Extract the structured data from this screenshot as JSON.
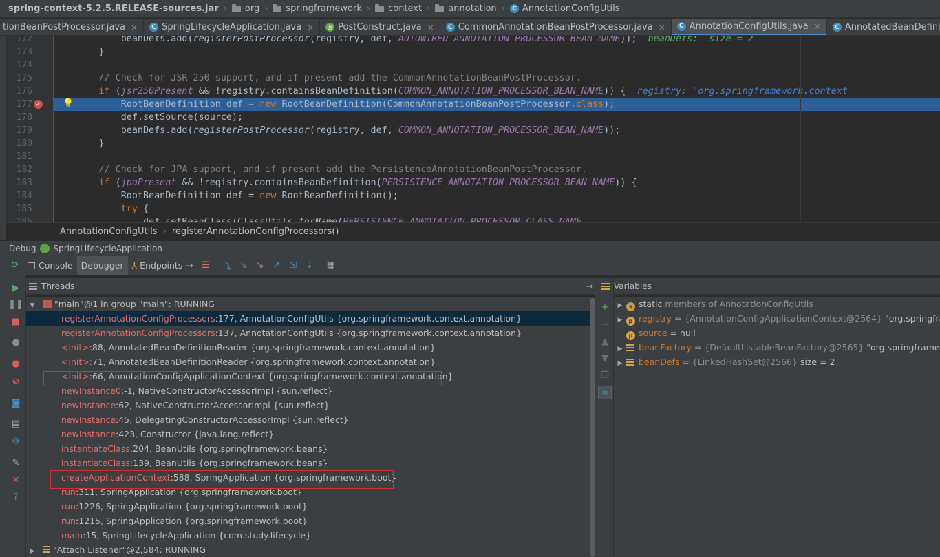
{
  "navbar": {
    "items": [
      "spring-context-5.2.5.RELEASE-sources.jar",
      "org",
      "springframework",
      "context",
      "annotation",
      "AnnotationConfigUtils"
    ]
  },
  "tabs": [
    {
      "label": "tionBeanPostProcessor.java",
      "icon": "class-icon"
    },
    {
      "label": "SpringLifecycleApplication.java",
      "icon": "spring-class-icon"
    },
    {
      "label": "PostConstruct.java",
      "icon": "annotation-icon"
    },
    {
      "label": "CommonAnnotationBeanPostProcessor.java",
      "icon": "class-icon"
    },
    {
      "label": "AnnotationConfigUtils.java",
      "icon": "class-icon",
      "active": true
    },
    {
      "label": "AnnotatedBeanDefinitionReader.java",
      "icon": "class-icon"
    }
  ],
  "editor": {
    "line_numbers": [
      "172",
      "173",
      "174",
      "175",
      "176",
      "177",
      "178",
      "179",
      "180",
      "181",
      "182",
      "183",
      "184",
      "185",
      "186"
    ],
    "current_line": "177",
    "lines": {
      "l172_a": "            beanDefs.add(",
      "l172_b": "registerPostProcessor",
      "l172_c": "(registry, def, ",
      "l172_d": "AUTOWIRED_ANNOTATION_PROCESSOR_BEAN_NAME",
      "l172_e": "));  ",
      "l172_f": "beanDefs:  size = 2",
      "l173": "        }",
      "l175": "        // Check for JSR-250 support, and if present add the CommonAnnotationBeanPostProcessor.",
      "l176_kw": "if",
      "l176_a": " (",
      "l176_b": "jsr250Present",
      "l176_c": " && !registry.containsBeanDefinition(",
      "l176_d": "COMMON_ANNOTATION_PROCESSOR_BEAN_NAME",
      "l176_e": ")) {  ",
      "l176_f": "registry: \"org.springframework.context",
      "l177_a": "            RootBeanDefinition def = ",
      "l177_kw": "new",
      "l177_b": " RootBeanDefinition(CommonAnnotationBeanPostProcessor.",
      "l177_kw2": "class",
      "l177_c": ");",
      "l178": "            def.setSource(source);",
      "l179_a": "            beanDefs.add(",
      "l179_b": "registerPostProcessor",
      "l179_c": "(registry, def, ",
      "l179_d": "COMMON_ANNOTATION_PROCESSOR_BEAN_NAME",
      "l179_e": "));",
      "l180": "        }",
      "l182": "        // Check for JPA support, and if present add the PersistenceAnnotationBeanPostProcessor.",
      "l183_kw": "if",
      "l183_a": " (",
      "l183_b": "jpaPresent",
      "l183_c": " && !registry.containsBeanDefinition(",
      "l183_d": "PERSISTENCE_ANNOTATION_PROCESSOR_BEAN_NAME",
      "l183_e": ")) {",
      "l184_a": "            RootBeanDefinition def = ",
      "l184_kw": "new",
      "l184_b": " RootBeanDefinition();",
      "l185_kw": "try",
      "l185_a": " {",
      "l186_a": "                def.setBeanClass(ClassUtils.",
      "l186_b": "forName",
      "l186_c": "(",
      "l186_d": "PERSISTENCE_ANNOTATION_PROCESSOR_CLASS_NAME"
    }
  },
  "method_crumb": {
    "class": "AnnotationConfigUtils",
    "method": "registerAnnotationConfigProcessors()"
  },
  "debug": {
    "title": "Debug",
    "config": "SpringLifecycleApplication",
    "tabs": {
      "console": "Console",
      "debugger": "Debugger",
      "endpoints": "Endpoints"
    },
    "threads_label": "Threads",
    "variables_label": "Variables",
    "main_thread": "\"main\"@1 in group \"main\": RUNNING",
    "frames": [
      {
        "method": "registerAnnotationConfigProcessors",
        "rest": ":177, AnnotationConfigUtils {org.springframework.context.annotation}"
      },
      {
        "method": "registerAnnotationConfigProcessors",
        "rest": ":137, AnnotationConfigUtils {org.springframework.context.annotation}"
      },
      {
        "method": "<init>",
        "rest": ":88, AnnotatedBeanDefinitionReader {org.springframework.context.annotation}"
      },
      {
        "method": "<init>",
        "rest": ":71, AnnotatedBeanDefinitionReader {org.springframework.context.annotation}"
      },
      {
        "method": "<init>",
        "rest": ":66, AnnotationConfigApplicationContext {org.springframework.context.annotation}"
      },
      {
        "method": "newInstance0",
        "rest": ":-1, NativeConstructorAccessorImpl {sun.reflect}"
      },
      {
        "method": "newInstance",
        "rest": ":62, NativeConstructorAccessorImpl {sun.reflect}"
      },
      {
        "method": "newInstance",
        "rest": ":45, DelegatingConstructorAccessorImpl {sun.reflect}"
      },
      {
        "method": "newInstance",
        "rest": ":423, Constructor {java.lang.reflect}"
      },
      {
        "method": "instantiateClass",
        "rest": ":204, BeanUtils {org.springframework.beans}"
      },
      {
        "method": "instantiateClass",
        "rest": ":139, BeanUtils {org.springframework.beans}"
      },
      {
        "method": "createApplicationContext",
        "rest": ":588, SpringApplication {org.springframework.boot}"
      },
      {
        "method": "run",
        "rest": ":311, SpringApplication {org.springframework.boot}"
      },
      {
        "method": "run",
        "rest": ":1226, SpringApplication {org.springframework.boot}"
      },
      {
        "method": "run",
        "rest": ":1215, SpringApplication {org.springframework.boot}"
      },
      {
        "method": "main",
        "rest": ":15, SpringLifecycleApplication {com.study.lifecycle}"
      }
    ],
    "attach_thread": "\"Attach Listener\"@2,584: RUNNING",
    "variables": [
      {
        "name": "static",
        "type": "",
        "value": " members of AnnotationConfigUtils"
      },
      {
        "name": "registry",
        "type": " = {AnnotationConfigApplicationContext@2564} ",
        "value": "\"org.springframew"
      },
      {
        "name": "source",
        "type": "",
        "value": " = null"
      },
      {
        "name": "beanFactory",
        "type": " = {DefaultListableBeanFactory@2565} ",
        "value": "\"org.springframework.b"
      },
      {
        "name": "beanDefs",
        "type": " = {LinkedHashSet@2566} ",
        "value": " size = 2"
      }
    ]
  },
  "colors": {
    "accent": "#4a88c7",
    "selection": "#2d6099",
    "breakpoint": "#c75450",
    "highlight_box": "#d32f2f"
  }
}
